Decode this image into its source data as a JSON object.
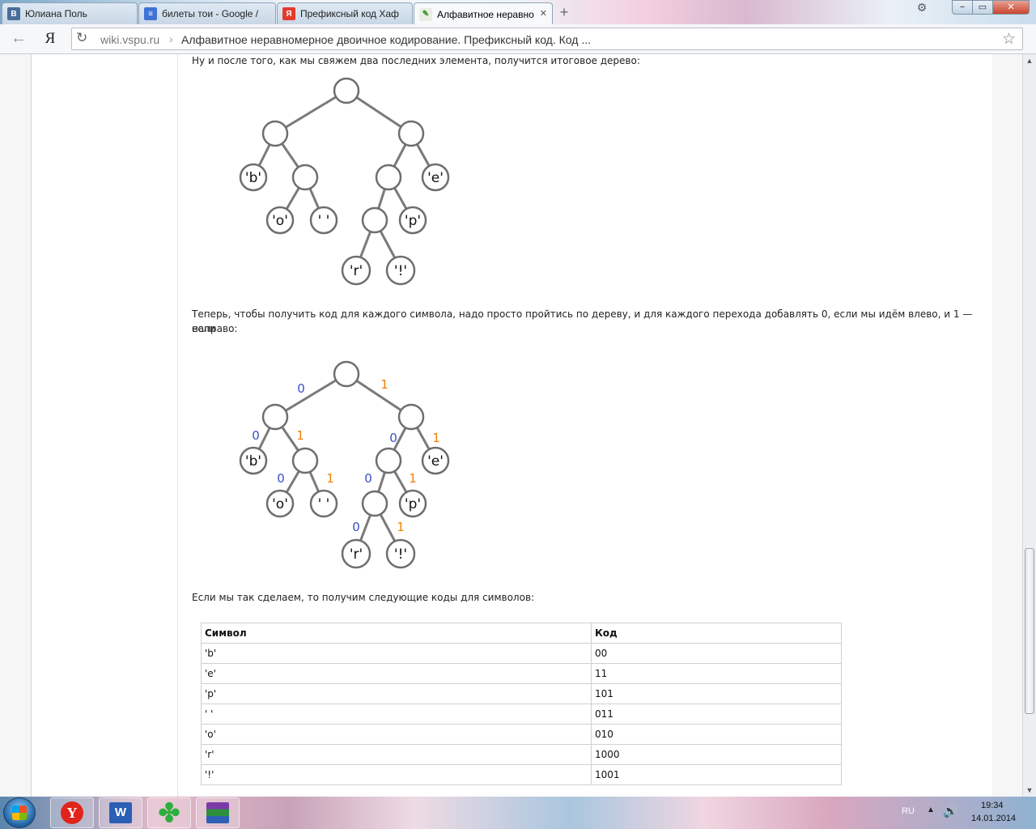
{
  "tabs": [
    {
      "label": "Юлиана Поль",
      "icon": "vk-icon",
      "active": false
    },
    {
      "label": "билеты тои - Google /",
      "icon": "google-docs-icon",
      "active": false
    },
    {
      "label": "Префиксный код Хаф",
      "icon": "yandex-icon",
      "active": false
    },
    {
      "label": "Алфавитное неравно",
      "icon": "page-icon",
      "active": true
    }
  ],
  "window": {
    "new_tab": "+",
    "min": "−",
    "max": "▭",
    "close": "✕",
    "settings": "⚙"
  },
  "toolbar": {
    "back": "←",
    "yandex": "Я",
    "url_domain": "wiki.vspu.ru",
    "url_sep": "›",
    "url_title": "Алфавитное неравномерное двоичное кодирование. Префиксный код. Код ...",
    "star": "☆",
    "reload": "↻"
  },
  "article": {
    "intro": "Ну и после того, как мы свяжем два последних элемента, получится итоговое дерево:",
    "walk_line1": "Теперь, чтобы получить код для каждого символа, надо просто пройтись по дереву, и для каждого перехода добавлять 0, если мы идём влево, и 1 — если",
    "walk_line2": "направо:",
    "result": "Если мы так сделаем, то получим следующие коды для символов:"
  },
  "tree": {
    "leaves": {
      "b": "'b'",
      "e": "'e'",
      "o": "'o'",
      "space": "' '",
      "p": "'p'",
      "r": "'r'",
      "excl": "'!'"
    },
    "bits": {
      "zero": "0",
      "one": "1"
    }
  },
  "table": {
    "headers": {
      "symbol": "Символ",
      "code": "Код"
    },
    "rows": [
      {
        "symbol": "'b'",
        "code": "00"
      },
      {
        "symbol": "'e'",
        "code": "11"
      },
      {
        "symbol": "'p'",
        "code": "101"
      },
      {
        "symbol": "' '",
        "code": "011"
      },
      {
        "symbol": "'o'",
        "code": "010"
      },
      {
        "symbol": "'r'",
        "code": "1000"
      },
      {
        "symbol": "'!'",
        "code": "1001"
      }
    ]
  },
  "taskbar": {
    "tray_lang": "RU",
    "tray_arrow": "▲",
    "tray_volume": "🔊",
    "time": "19:34",
    "date": "14.01.2014"
  },
  "colors": {
    "bit_zero": "#3a4fc4",
    "bit_one": "#f0820a"
  }
}
